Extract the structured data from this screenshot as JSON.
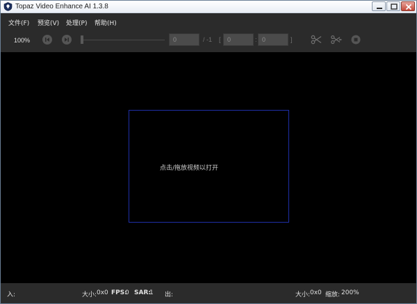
{
  "window": {
    "title": "Topaz Video Enhance AI 1.3.8"
  },
  "menu": {
    "items": [
      "文件(F)",
      "预览(V)",
      "处理(P)",
      "帮助(H)"
    ]
  },
  "toolbar": {
    "zoom": "100%",
    "frame_value": "0",
    "frame_total": "/ -1",
    "bracket_open": "[",
    "range_start": "0",
    "range_sep": ":",
    "range_end": "0",
    "bracket_close": "]"
  },
  "viewport": {
    "drop_hint": "点击/拖放视频以打开"
  },
  "status": {
    "in_label": "入:",
    "in_size_label": "大小:",
    "in_size_value": "0x0",
    "fps_label": "FPS:",
    "fps_value": "0",
    "sar_label": "SAR:",
    "sar_value": "1",
    "out_label": "出:",
    "out_size_label": "大小:",
    "out_size_value": "0x0",
    "zoom_label": "缩放:",
    "zoom_value": "200%"
  },
  "colors": {
    "background": "#2b2b2b",
    "viewport": "#000000",
    "drop_border": "#1f2fa8"
  }
}
